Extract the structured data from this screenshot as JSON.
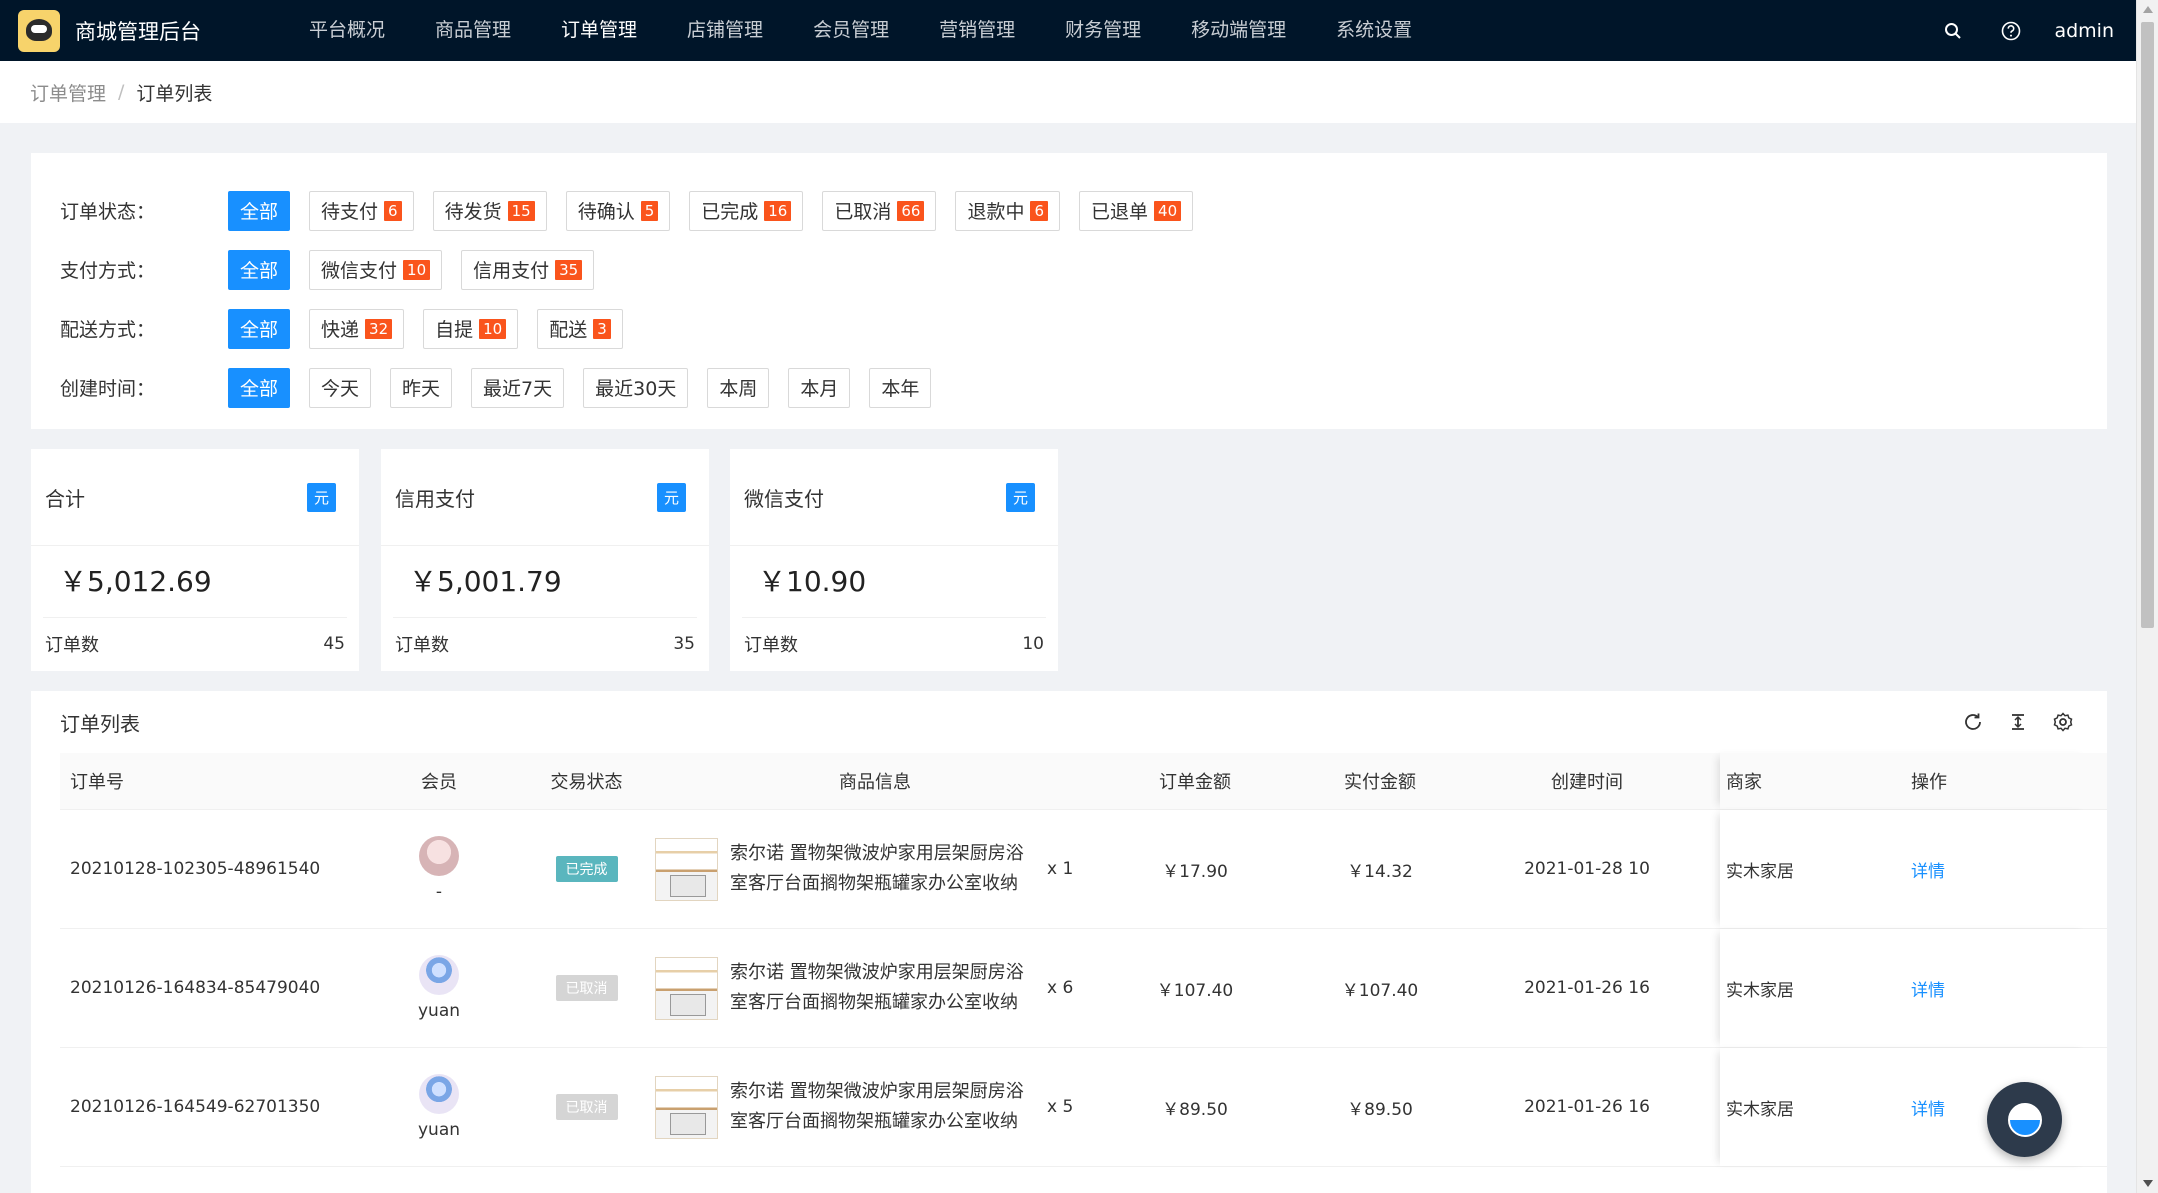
{
  "app": {
    "title": "商城管理后台",
    "user": "admin"
  },
  "nav": {
    "items": [
      {
        "label": "平台概况"
      },
      {
        "label": "商品管理"
      },
      {
        "label": "订单管理"
      },
      {
        "label": "店铺管理"
      },
      {
        "label": "会员管理"
      },
      {
        "label": "营销管理"
      },
      {
        "label": "财务管理"
      },
      {
        "label": "移动端管理"
      },
      {
        "label": "系统设置"
      }
    ],
    "active": "订单管理"
  },
  "breadcrumb": {
    "parent": "订单管理",
    "separator": "/",
    "current": "订单列表"
  },
  "filters": {
    "status": {
      "label": "订单状态：",
      "options": [
        {
          "label": "全部"
        },
        {
          "label": "待支付",
          "count": "6"
        },
        {
          "label": "待发货",
          "count": "15"
        },
        {
          "label": "待确认",
          "count": "5"
        },
        {
          "label": "已完成",
          "count": "16"
        },
        {
          "label": "已取消",
          "count": "66"
        },
        {
          "label": "退款中",
          "count": "6"
        },
        {
          "label": "已退单",
          "count": "40"
        }
      ]
    },
    "payment": {
      "label": "支付方式：",
      "options": [
        {
          "label": "全部"
        },
        {
          "label": "微信支付",
          "count": "10"
        },
        {
          "label": "信用支付",
          "count": "35"
        }
      ]
    },
    "delivery": {
      "label": "配送方式：",
      "options": [
        {
          "label": "全部"
        },
        {
          "label": "快递",
          "count": "32"
        },
        {
          "label": "自提",
          "count": "10"
        },
        {
          "label": "配送",
          "count": "3"
        }
      ]
    },
    "created": {
      "label": "创建时间：",
      "options": [
        {
          "label": "全部"
        },
        {
          "label": "今天"
        },
        {
          "label": "昨天"
        },
        {
          "label": "最近7天"
        },
        {
          "label": "最近30天"
        },
        {
          "label": "本周"
        },
        {
          "label": "本月"
        },
        {
          "label": "本年"
        }
      ]
    }
  },
  "stats": [
    {
      "title": "合计",
      "unit": "元",
      "amount": "￥5,012.69",
      "count_label": "订单数",
      "count": "45"
    },
    {
      "title": "信用支付",
      "unit": "元",
      "amount": "￥5,001.79",
      "count_label": "订单数",
      "count": "35"
    },
    {
      "title": "微信支付",
      "unit": "元",
      "amount": "￥10.90",
      "count_label": "订单数",
      "count": "10"
    }
  ],
  "table": {
    "title": "订单列表",
    "columns": {
      "order_no": "订单号",
      "member": "会员",
      "status": "交易状态",
      "goods": "商品信息",
      "amount": "订单金额",
      "paid": "实付金额",
      "created": "创建时间",
      "merchant": "商家",
      "action": "操作"
    },
    "rows": [
      {
        "order_no": "20210128-102305-48961540",
        "member": "-",
        "status": "已完成",
        "goods": "索尔诺 置物架微波炉家用层架厨房浴室客厅台面搁物架瓶罐家办公室收纳架储...",
        "qty": "x 1",
        "amount": "￥17.90",
        "paid": "￥14.32",
        "created": "2021-01-28 10",
        "merchant": "实木家居",
        "action": "详情"
      },
      {
        "order_no": "20210126-164834-85479040",
        "member": "yuan",
        "status": "已取消",
        "goods": "索尔诺 置物架微波炉家用层架厨房浴室客厅台面搁物架瓶罐家办公室收纳架储...",
        "qty": "x 6",
        "amount": "￥107.40",
        "paid": "￥107.40",
        "created": "2021-01-26 16",
        "merchant": "实木家居",
        "action": "详情"
      },
      {
        "order_no": "20210126-164549-62701350",
        "member": "yuan",
        "status": "已取消",
        "goods": "索尔诺 置物架微波炉家用层架厨房浴室客厅台面搁物架瓶罐家办公室收纳架储...",
        "qty": "x 5",
        "amount": "￥89.50",
        "paid": "￥89.50",
        "created": "2021-01-26 16",
        "merchant": "实木家居",
        "action": "详情"
      }
    ]
  },
  "colors": {
    "header_bg": "#001529",
    "primary": "#1890ff",
    "count_badge": "#fa541c",
    "done": "#5ab6be",
    "cancel": "#d5d5d5"
  }
}
